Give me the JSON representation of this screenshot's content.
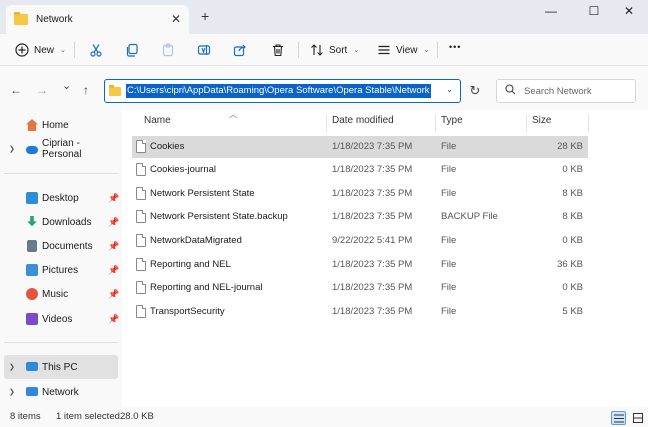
{
  "window": {
    "tab_title": "Network",
    "new_tab_glyph": "+",
    "close_tab_glyph": "✕",
    "minimize_glyph": "—",
    "maximize_glyph": "☐",
    "close_glyph": "✕"
  },
  "toolbar": {
    "new_label": "New",
    "sort_label": "Sort",
    "view_label": "View",
    "more_glyph": "•••",
    "icons": [
      "plus-circle-icon",
      "cut-icon",
      "copy-icon",
      "paste-icon",
      "rename-icon",
      "share-icon",
      "delete-icon",
      "sort-icon",
      "view-icon"
    ]
  },
  "nav": {
    "back": "←",
    "forward": "→",
    "recent": "⌄",
    "up": "↑",
    "address_value": "C:\\Users\\cipri\\AppData\\Roaming\\Opera Software\\Opera Stable\\Network",
    "address_dropdown": "⌄",
    "refresh": "↻",
    "search_placeholder": "Search Network"
  },
  "sidebar": {
    "items": [
      {
        "label": "Home",
        "icon": "home-icon",
        "color": "#e07a3f"
      },
      {
        "label": "Ciprian - Personal",
        "icon": "onedrive-icon",
        "color": "#1f7ad9"
      },
      {
        "label": "Desktop",
        "icon": "desktop-icon",
        "color": "#2b8fd8"
      },
      {
        "label": "Downloads",
        "icon": "download-icon",
        "color": "#28a36a"
      },
      {
        "label": "Documents",
        "icon": "documents-icon",
        "color": "#6a7a8c"
      },
      {
        "label": "Pictures",
        "icon": "pictures-icon",
        "color": "#3a8fd6"
      },
      {
        "label": "Music",
        "icon": "music-icon",
        "color": "#e2563d"
      },
      {
        "label": "Videos",
        "icon": "videos-icon",
        "color": "#7b4cc8"
      },
      {
        "label": "This PC",
        "icon": "this-pc-icon",
        "color": "#2d8ad6"
      },
      {
        "label": "Network",
        "icon": "network-icon",
        "color": "#2d8ad6"
      }
    ]
  },
  "columns": {
    "name": "Name",
    "date": "Date modified",
    "type": "Type",
    "size": "Size"
  },
  "files": [
    {
      "name": "Cookies",
      "date": "1/18/2023 7:35 PM",
      "type": "File",
      "size": "28 KB"
    },
    {
      "name": "Cookies-journal",
      "date": "1/18/2023 7:35 PM",
      "type": "File",
      "size": "0 KB"
    },
    {
      "name": "Network Persistent State",
      "date": "1/18/2023 7:35 PM",
      "type": "File",
      "size": "8 KB"
    },
    {
      "name": "Network Persistent State.backup",
      "date": "1/18/2023 7:35 PM",
      "type": "BACKUP File",
      "size": "8 KB"
    },
    {
      "name": "NetworkDataMigrated",
      "date": "9/22/2022 5:41 PM",
      "type": "File",
      "size": "0 KB"
    },
    {
      "name": "Reporting and NEL",
      "date": "1/18/2023 7:35 PM",
      "type": "File",
      "size": "36 KB"
    },
    {
      "name": "Reporting and NEL-journal",
      "date": "1/18/2023 7:35 PM",
      "type": "File",
      "size": "0 KB"
    },
    {
      "name": "TransportSecurity",
      "date": "1/18/2023 7:35 PM",
      "type": "File",
      "size": "5 KB"
    }
  ],
  "status": {
    "item_count": "8 items",
    "selection": "1 item selected",
    "selection_size": "28.0 KB"
  },
  "colors": {
    "accent": "#0a63c9",
    "selection_row": "#dadada"
  }
}
